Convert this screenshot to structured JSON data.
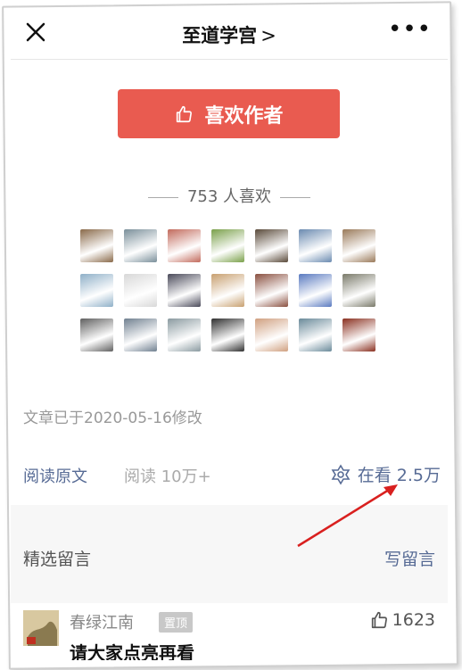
{
  "nav": {
    "title": "至道学宫",
    "title_chevron": ">",
    "more": "•••"
  },
  "like": {
    "button_label": "喜欢作者",
    "count_text": "753 人喜欢"
  },
  "avatars": [
    {
      "color": "#8a6a4a"
    },
    {
      "color": "#7a8f9a"
    },
    {
      "color": "#c26a5c"
    },
    {
      "color": "#7aa04a"
    },
    {
      "color": "#5a4a3a"
    },
    {
      "color": "#6a8ab0"
    },
    {
      "color": "#9a7a5a"
    },
    {
      "color": "#8fb0c8"
    },
    {
      "color": "#d8d8d8"
    },
    {
      "color": "#4a4a5a"
    },
    {
      "color": "#c8a070"
    },
    {
      "color": "#8a5040"
    },
    {
      "color": "#5a7ac0"
    },
    {
      "color": "#7a7a6a"
    },
    {
      "color": "#606060"
    },
    {
      "color": "#708090"
    },
    {
      "color": "#8a9aa0"
    },
    {
      "color": "#303030"
    },
    {
      "color": "#d0a080"
    },
    {
      "color": "#6a8a9a"
    },
    {
      "color": "#8a3020"
    }
  ],
  "meta": {
    "modified": "文章已于2020-05-16修改",
    "read_original": "阅读原文",
    "read_count": "阅读 10万+",
    "looking": "在看 2.5万"
  },
  "comments": {
    "header": "精选留言",
    "write": "写留言",
    "items": [
      {
        "name": "春绿江南",
        "badge": "置顶",
        "text": "请大家点亮再看",
        "likes": "1623"
      }
    ]
  },
  "colors": {
    "accent_red": "#e95b50",
    "link_blue": "#576b95",
    "annotation_arrow": "#d9201f"
  }
}
